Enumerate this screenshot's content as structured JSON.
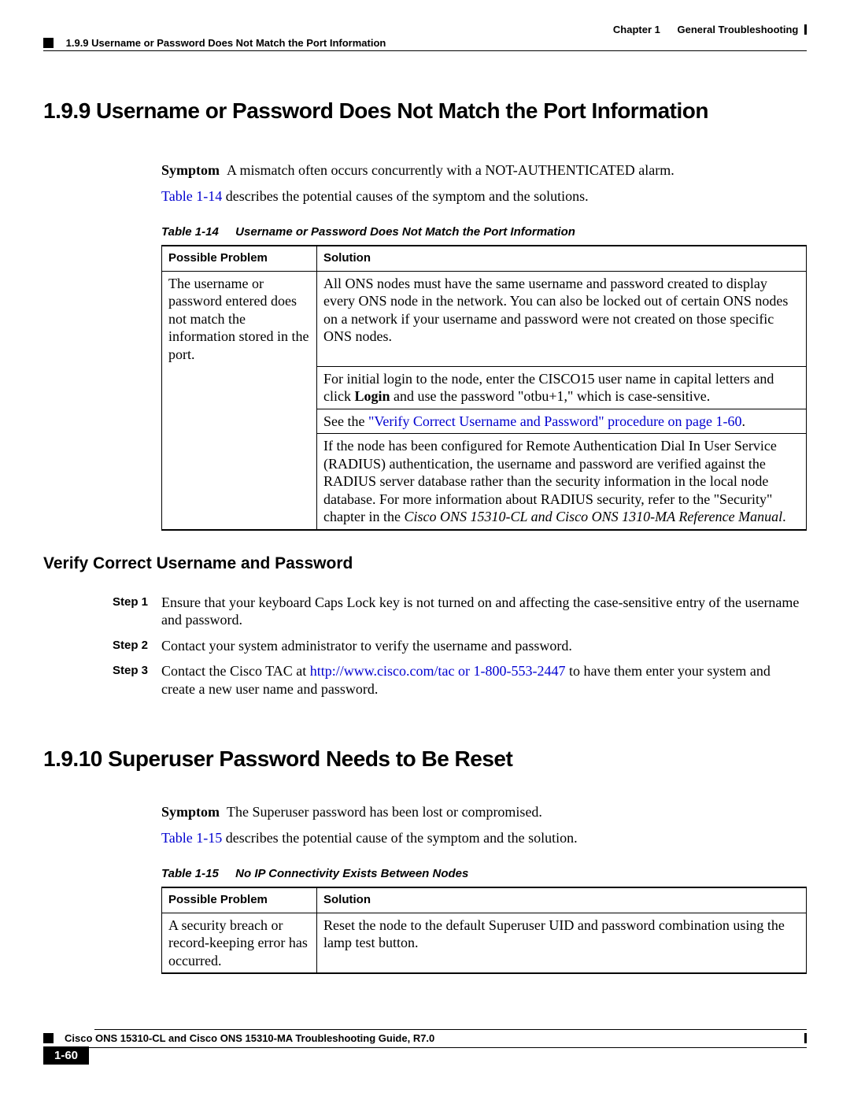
{
  "header": {
    "chapter_label": "Chapter 1",
    "chapter_title": "General Troubleshooting",
    "running_section": "1.9.9   Username or Password Does Not Match the Port Information"
  },
  "section199": {
    "heading": "1.9.9  Username or Password Does Not Match the Port Information",
    "symptom_label": "Symptom",
    "symptom_text": "A mismatch often occurs concurrently with a NOT-AUTHENTICATED alarm.",
    "intro_link": "Table 1-14",
    "intro_rest": " describes the potential causes of the symptom and the solutions.",
    "table_num": "Table 1-14",
    "table_title": "Username or Password Does Not Match the Port Information",
    "col_problem": "Possible Problem",
    "col_solution": "Solution",
    "problem": "The username or password entered does not match the information stored in the port.",
    "sol1": "All ONS nodes must have the same username and password created to display every ONS node in the network. You can also be locked out of certain ONS nodes on a network if your username and password were not created on those specific ONS nodes.",
    "sol2_a": "For initial login to the node, enter the CISCO15 user name in capital letters and click ",
    "sol2_b": "Login",
    "sol2_c": " and use the password \"otbu+1,\" which is case-sensitive.",
    "sol3_a": "See the ",
    "sol3_link": "\"Verify Correct Username and Password\" procedure on page 1-60",
    "sol3_c": ".",
    "sol4_a": "If the node has been configured for Remote Authentication Dial In User Service (RADIUS) authentication, the username and password are verified against the RADIUS server database rather than the security information in the local node database. For more information about RADIUS security, refer to the \"Security\" chapter in the ",
    "sol4_i": "Cisco ONS 15310-CL and Cisco ONS 1310-MA Reference Manual",
    "sol4_c": "."
  },
  "verify": {
    "heading": "Verify Correct Username and Password",
    "steps": [
      {
        "label": "Step 1",
        "a": "Ensure that your keyboard Caps Lock key is not turned on and affecting the case-sensitive entry of the username and password."
      },
      {
        "label": "Step 2",
        "a": "Contact your system administrator to verify the username and password."
      },
      {
        "label": "Step 3",
        "a": "Contact the Cisco TAC at ",
        "link": "http://www.cisco.com/tac or 1-800-553-2447",
        "c": " to have them enter your system and create a new user name and password."
      }
    ]
  },
  "section1910": {
    "heading": "1.9.10  Superuser Password Needs to Be Reset",
    "symptom_label": "Symptom",
    "symptom_text": "The Superuser password has been lost or compromised.",
    "intro_link": "Table 1-15",
    "intro_rest": " describes the potential cause of the symptom and the solution.",
    "table_num": "Table 1-15",
    "table_title": "No IP Connectivity Exists Between Nodes",
    "col_problem": "Possible Problem",
    "col_solution": "Solution",
    "problem": "A security breach or record-keeping error has occurred.",
    "sol1": "Reset the node to the default Superuser UID and password combination using the lamp test button."
  },
  "footer": {
    "doc_title": "Cisco ONS 15310-CL and Cisco ONS 15310-MA Troubleshooting Guide, R7.0",
    "page": "1-60"
  }
}
